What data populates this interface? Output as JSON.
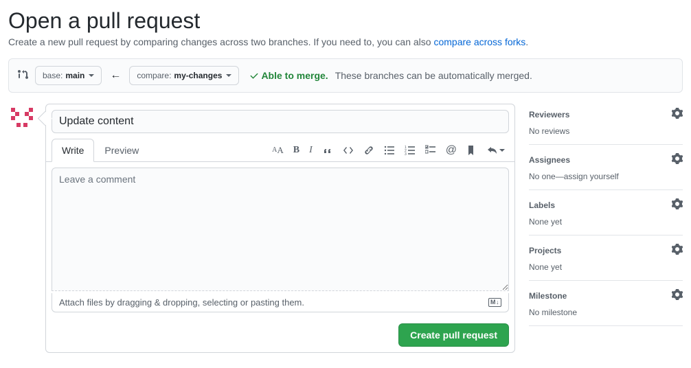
{
  "header": {
    "title": "Open a pull request",
    "subhead_prefix": "Create a new pull request by comparing changes across two branches. If you need to, you can also ",
    "compare_link": "compare across forks",
    "period": "."
  },
  "range": {
    "base_label": "base:",
    "base_branch": "main",
    "compare_label": "compare:",
    "compare_branch": "my-changes",
    "merge_status": "Able to merge.",
    "merge_sub": "These branches can be automatically merged."
  },
  "form": {
    "title_value": "Update content",
    "tabs": {
      "write": "Write",
      "preview": "Preview"
    },
    "body_placeholder": "Leave a comment",
    "attach_hint": "Attach files by dragging & dropping, selecting or pasting them.",
    "submit": "Create pull request",
    "md_badge": "M↓"
  },
  "sidebar": {
    "reviewers": {
      "title": "Reviewers",
      "body": "No reviews"
    },
    "assignees": {
      "title": "Assignees",
      "body_prefix": "No one—",
      "assign_self": "assign yourself"
    },
    "labels": {
      "title": "Labels",
      "body": "None yet"
    },
    "projects": {
      "title": "Projects",
      "body": "None yet"
    },
    "milestone": {
      "title": "Milestone",
      "body": "No milestone"
    }
  }
}
